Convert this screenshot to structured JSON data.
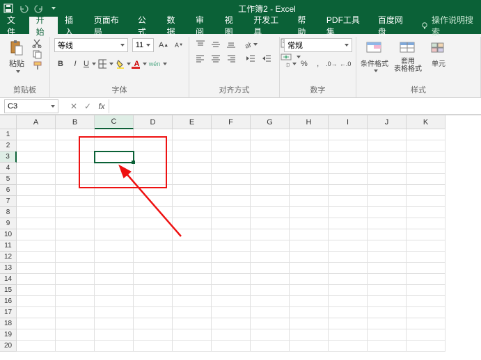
{
  "app": {
    "title": "工作簿2 - Excel"
  },
  "tabs": {
    "file": "文件",
    "home": "开始",
    "insert": "插入",
    "layout": "页面布局",
    "formulas": "公式",
    "data": "数据",
    "review": "审阅",
    "view": "视图",
    "dev": "开发工具",
    "help": "帮助",
    "pdf": "PDF工具集",
    "baidu": "百度网盘",
    "tellme": "操作说明搜索"
  },
  "ribbon": {
    "clipboard": {
      "paste": "粘贴",
      "label": "剪贴板"
    },
    "font": {
      "name": "等线",
      "size": "11",
      "label": "字体",
      "wen": "wén"
    },
    "align": {
      "wrap": "ab",
      "merge": "",
      "label": "对齐方式"
    },
    "number": {
      "format": "常规",
      "label": "数字"
    },
    "styles": {
      "cond": "条件格式",
      "tbl": "套用\n表格格式",
      "cell": "单元",
      "label": "样式"
    }
  },
  "namebox": "C3",
  "columns": [
    "A",
    "B",
    "C",
    "D",
    "E",
    "F",
    "G",
    "H",
    "I",
    "J",
    "K"
  ],
  "rows": [
    "1",
    "2",
    "3",
    "4",
    "5",
    "6",
    "7",
    "8",
    "9",
    "10",
    "11",
    "12",
    "13",
    "14",
    "15",
    "16",
    "17",
    "18",
    "19",
    "20"
  ],
  "selectedCol": 2,
  "selectedRow": 2
}
